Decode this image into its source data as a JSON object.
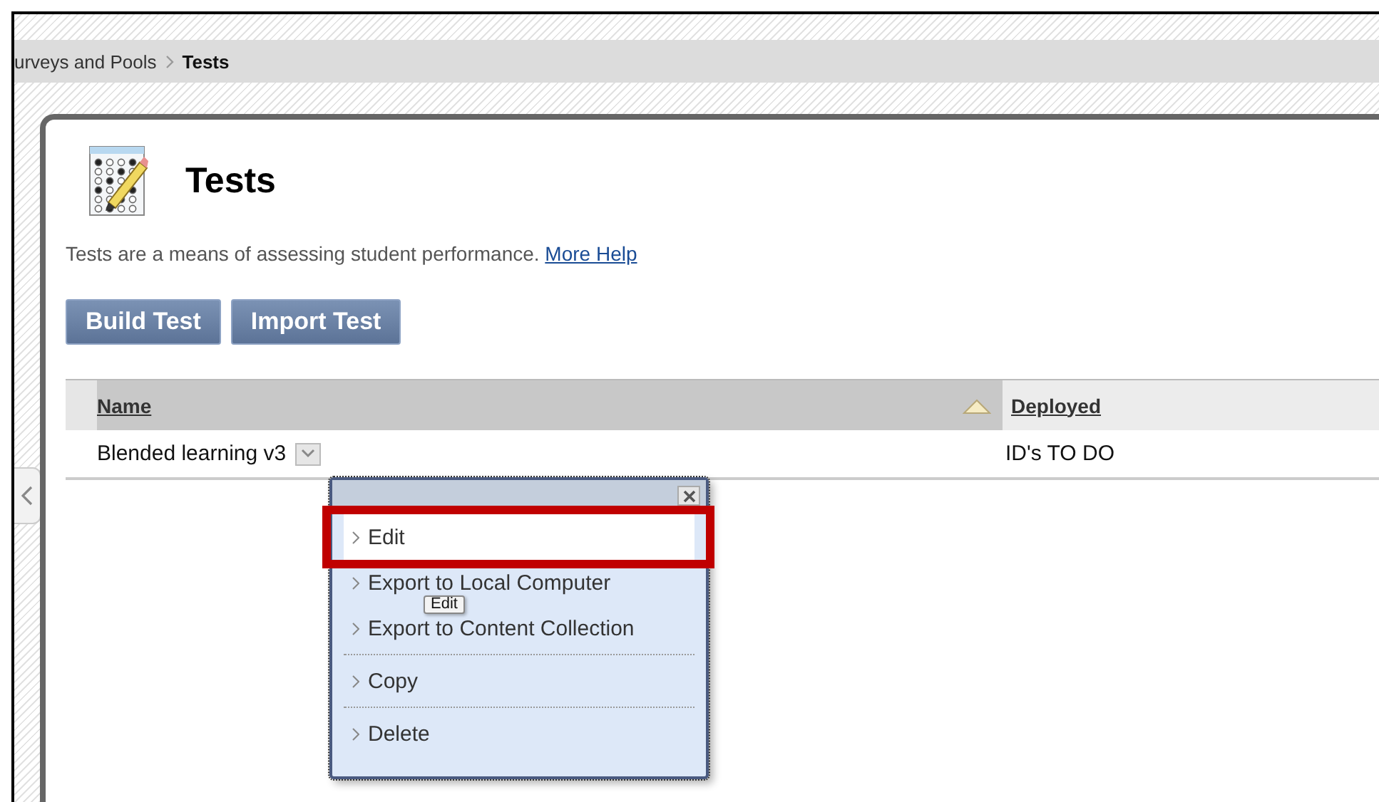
{
  "breadcrumb": {
    "items": [
      "urveys and Pools",
      "Tests"
    ]
  },
  "page": {
    "title": "Tests",
    "description": "Tests are a means of assessing student performance.",
    "help_link": "More Help"
  },
  "buttons": [
    "Build Test",
    "Import Test"
  ],
  "table": {
    "columns": [
      {
        "label": "Name",
        "sorted": true
      },
      {
        "label": "Deployed",
        "sorted": false
      }
    ],
    "rows": [
      {
        "cells": [
          "Blended learning v3",
          "ID's TO DO"
        ]
      }
    ]
  },
  "context_menu": {
    "groups": [
      [
        {
          "label": "Edit",
          "selected": true
        },
        {
          "label": "Export to Local Computer",
          "selected": false
        },
        {
          "label": "Export to Content Collection",
          "selected": false
        }
      ],
      [
        {
          "label": "Copy",
          "selected": false
        }
      ],
      [
        {
          "label": "Delete",
          "selected": false
        }
      ]
    ]
  },
  "tooltip": "Edit"
}
